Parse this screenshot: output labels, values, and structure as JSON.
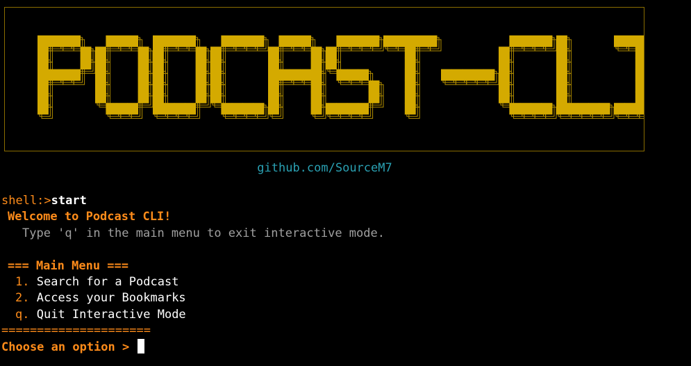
{
  "banner": {
    "text": "PODCAST-CLI",
    "fill_color": "#d4aa00",
    "outline_color": "#b38f00",
    "border_color": "#8a6d00"
  },
  "link": "github.com/SourceM7",
  "terminal": {
    "prompt": "shell:>",
    "command": "start",
    "welcome": "Welcome to Podcast CLI!",
    "hint": "Type 'q' in the main menu to exit interactive mode.",
    "menu_title": "=== Main Menu ===",
    "menu_items": [
      {
        "key": "1.",
        "label": "Search for a Podcast"
      },
      {
        "key": "2.",
        "label": "Access your Bookmarks"
      },
      {
        "key": "q.",
        "label": "Quit Interactive Mode"
      }
    ],
    "separator": "=====================",
    "input_prompt": "Choose an option > "
  }
}
